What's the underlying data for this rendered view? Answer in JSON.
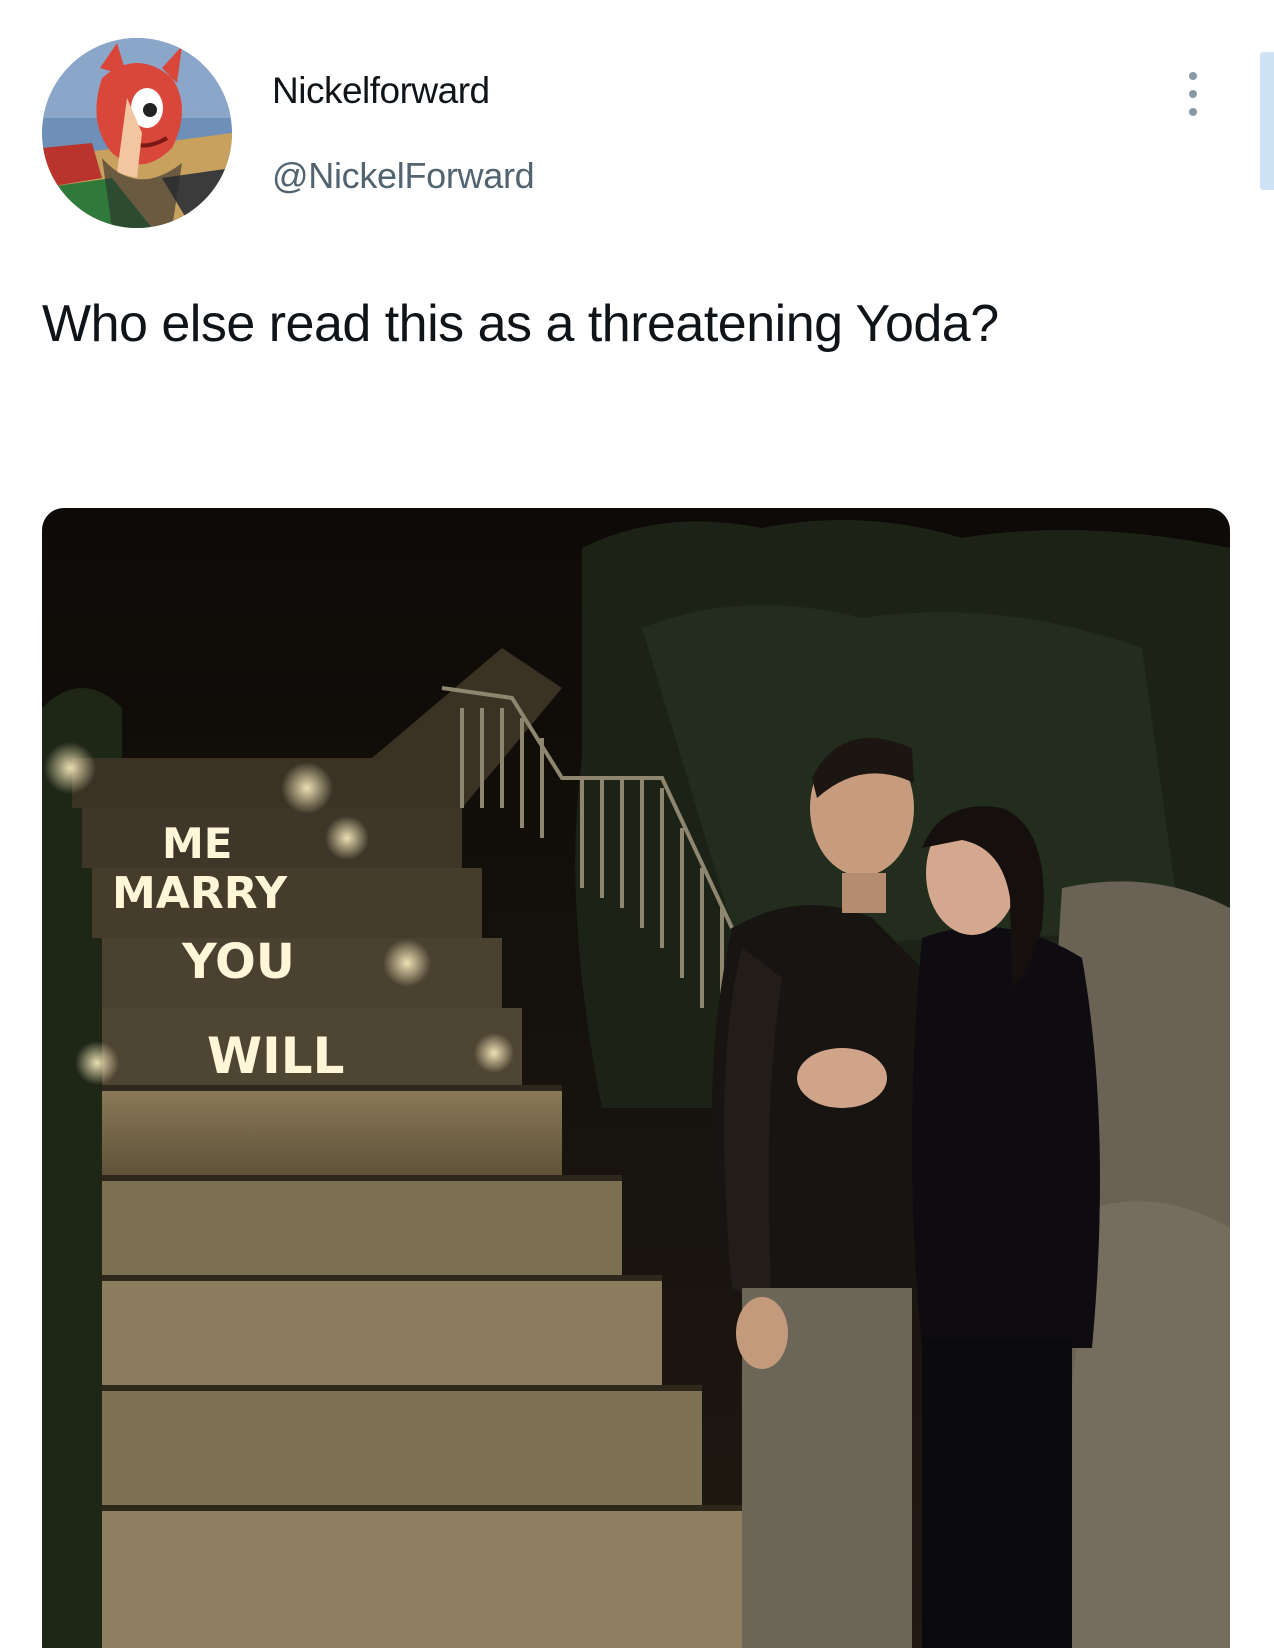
{
  "author": {
    "display_name": "Nickelforward",
    "handle": "@NickelForward",
    "avatar_icon": "cartoon-avatar"
  },
  "tweet": {
    "text": "Who else read this as a threatening Yoda?"
  },
  "media": {
    "description_icon": "photo",
    "stair_signs": [
      "ME",
      "MARRY",
      "YOU",
      "WILL"
    ]
  },
  "controls": {
    "more_icon": "more-vertical-icon"
  },
  "colors": {
    "text_primary": "#0f1419",
    "text_secondary": "#536471",
    "icon_gray": "#8899a6",
    "follow_accent": "#cfe3f7"
  }
}
